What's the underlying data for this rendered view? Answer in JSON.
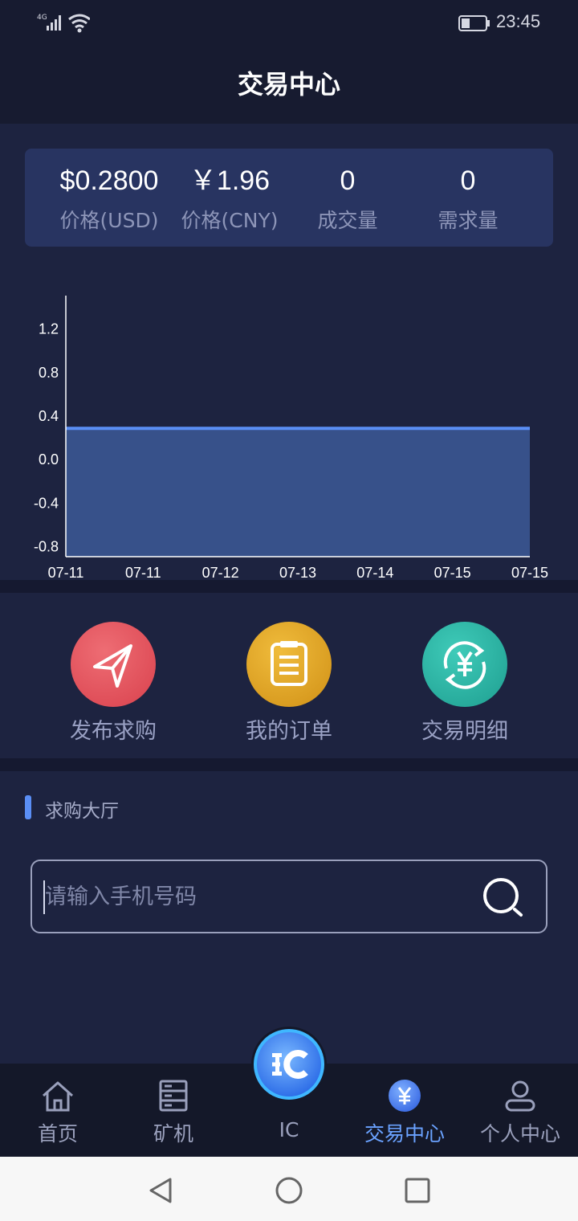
{
  "status_bar": {
    "network": "4G",
    "time": "23:45"
  },
  "header": {
    "title": "交易中心"
  },
  "stats": [
    {
      "value": "$0.2800",
      "label": "价格(USD)"
    },
    {
      "value": "￥1.96",
      "label": "价格(CNY)"
    },
    {
      "value": "0",
      "label": "成交量"
    },
    {
      "value": "0",
      "label": "需求量"
    }
  ],
  "chart_data": {
    "type": "area",
    "x": [
      "07-11",
      "07-11",
      "07-12",
      "07-13",
      "07-14",
      "07-15",
      "07-15"
    ],
    "values": [
      0.28,
      0.28,
      0.28,
      0.28,
      0.28,
      0.28,
      0.28
    ],
    "yticks": [
      "1.2",
      "0.8",
      "0.4",
      "0.0",
      "-0.4",
      "-0.8"
    ],
    "ylim": [
      -0.9,
      1.5
    ],
    "title": "",
    "xlabel": "",
    "ylabel": "",
    "line_color": "#5a8ef5",
    "fill_color": "#37518a",
    "grid": false
  },
  "actions": [
    {
      "label": "发布求购",
      "icon": "send-icon",
      "color": "#e2525c"
    },
    {
      "label": "我的订单",
      "icon": "clipboard-icon",
      "color": "#d9a223"
    },
    {
      "label": "交易明细",
      "icon": "yuan-exchange-icon",
      "color": "#2ab3a3"
    }
  ],
  "hall": {
    "title": "求购大厅",
    "search_placeholder": "请输入手机号码"
  },
  "tabs": [
    {
      "label": "首页",
      "icon": "home-icon",
      "active": false
    },
    {
      "label": "矿机",
      "icon": "server-icon",
      "active": false
    },
    {
      "label": "IC",
      "icon": "ic-logo-icon",
      "active": false
    },
    {
      "label": "交易中心",
      "icon": "yuan-icon",
      "active": true
    },
    {
      "label": "个人中心",
      "icon": "user-icon",
      "active": false
    }
  ],
  "colors": {
    "accent": "#6aa2ff",
    "background": "#1d2340",
    "card": "#283461"
  }
}
